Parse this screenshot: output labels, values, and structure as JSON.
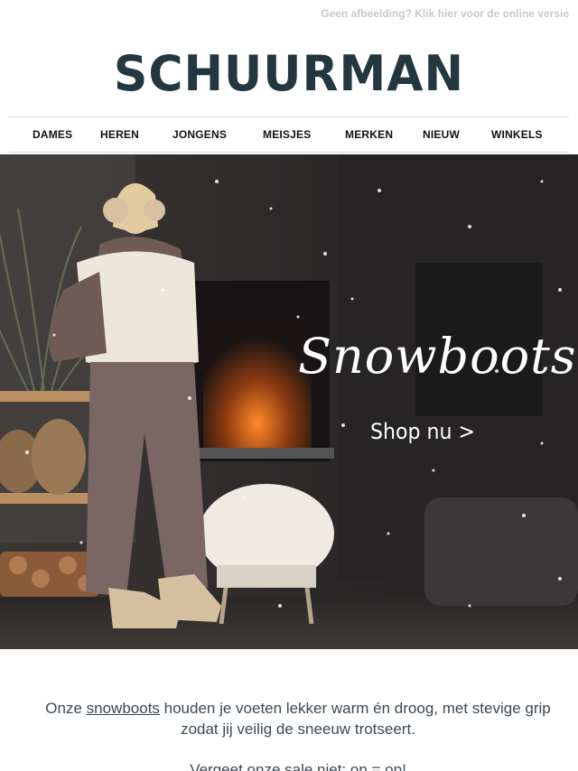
{
  "topbar": {
    "online_version": "Geen afbeelding? Klik hier voor de online versie"
  },
  "brand": {
    "logo_text": "SCHUURMAN"
  },
  "nav": {
    "items": [
      {
        "label": "DAMES"
      },
      {
        "label": "HEREN"
      },
      {
        "label": "JONGENS"
      },
      {
        "label": "MEISJES"
      },
      {
        "label": "MERKEN"
      },
      {
        "label": "NIEUW"
      },
      {
        "label": "WINKELS"
      }
    ]
  },
  "hero": {
    "title": "Snowboots",
    "cta": "Shop nu >"
  },
  "body": {
    "prefix": "Onze ",
    "link": "snowboots",
    "suffix": " houden je voeten lekker warm én droog, met stevige grip zodat jij veilig de sneeuw trotseert.",
    "line2": "Vergeet onze sale niet: op = op!"
  },
  "colors": {
    "logo": "#233741",
    "nav_text": "#111111",
    "body_text": "#3c4a52",
    "topbar_text": "#c9c9c9"
  }
}
